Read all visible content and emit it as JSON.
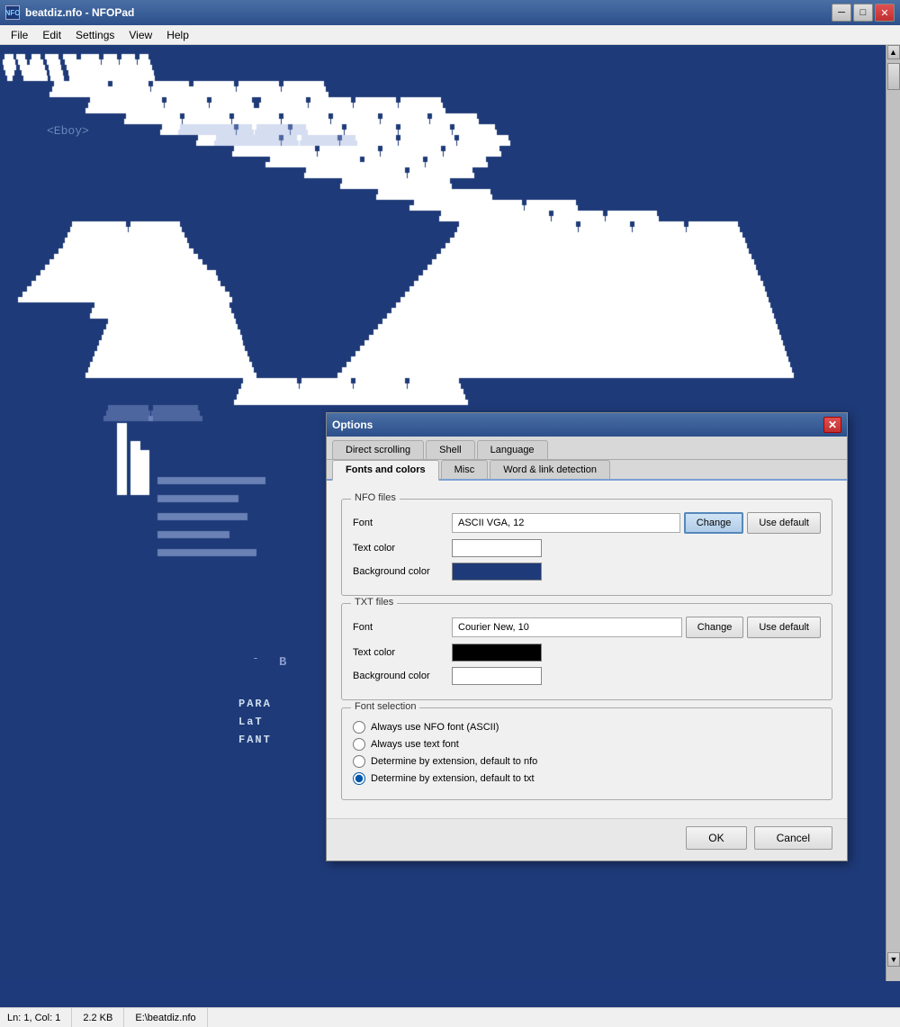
{
  "app": {
    "title": "beatdiz.nfo - NFOPad",
    "icon_label": "NFO"
  },
  "titlebar": {
    "minimize": "─",
    "maximize": "□",
    "close": "✕"
  },
  "menubar": {
    "items": [
      "File",
      "Edit",
      "Settings",
      "View",
      "Help"
    ]
  },
  "statusbar": {
    "position": "Ln: 1, Col: 1",
    "size": "2.2 KB",
    "filepath": "E:\\beatdiz.nfo"
  },
  "dialog": {
    "title": "Options",
    "close_label": "✕",
    "tabs_top": [
      {
        "label": "Direct scrolling",
        "active": false
      },
      {
        "label": "Shell",
        "active": false
      },
      {
        "label": "Language",
        "active": false
      }
    ],
    "tabs_bottom": [
      {
        "label": "Fonts and colors",
        "active": true
      },
      {
        "label": "Misc",
        "active": false
      },
      {
        "label": "Word & link detection",
        "active": false
      }
    ],
    "nfo_group": {
      "label": "NFO files",
      "font_label": "Font",
      "font_value": "ASCII VGA, 12",
      "change_btn": "Change",
      "use_default_btn": "Use default",
      "text_color_label": "Text color",
      "text_color": "#ffffff",
      "bg_color_label": "Background color",
      "bg_color": "#1e3a78"
    },
    "txt_group": {
      "label": "TXT files",
      "font_label": "Font",
      "font_value": "Courier New, 10",
      "change_btn": "Change",
      "use_default_btn": "Use default",
      "text_color_label": "Text color",
      "text_color": "#000000",
      "bg_color_label": "Background color",
      "bg_color": "#ffffff"
    },
    "font_selection": {
      "label": "Font selection",
      "options": [
        {
          "label": "Always use NFO font (ASCII)",
          "checked": false
        },
        {
          "label": "Always use text font",
          "checked": false
        },
        {
          "label": "Determine by extension, default to nfo",
          "checked": false
        },
        {
          "label": "Determine by extension, default to txt",
          "checked": true
        }
      ]
    },
    "ok_btn": "OK",
    "cancel_btn": "Cancel"
  }
}
